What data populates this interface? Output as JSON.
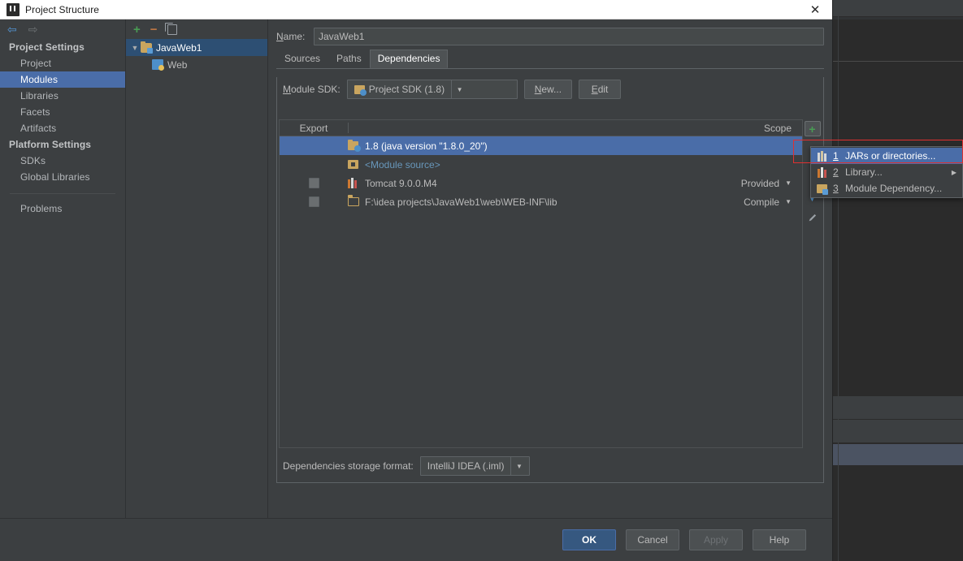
{
  "window": {
    "title": "Project Structure",
    "icon": "intellij-idea-icon",
    "close_label": "✕"
  },
  "nav": {
    "back_icon": "arrow-left-icon",
    "forward_icon": "arrow-right-icon",
    "groups": [
      {
        "label": "Project Settings",
        "items": [
          {
            "label": "Project",
            "selected": false
          },
          {
            "label": "Modules",
            "selected": true
          },
          {
            "label": "Libraries",
            "selected": false
          },
          {
            "label": "Facets",
            "selected": false
          },
          {
            "label": "Artifacts",
            "selected": false
          }
        ]
      },
      {
        "label": "Platform Settings",
        "items": [
          {
            "label": "SDKs",
            "selected": false
          },
          {
            "label": "Global Libraries",
            "selected": false
          }
        ]
      }
    ],
    "problems": "Problems"
  },
  "tree": {
    "toolbar": {
      "add": "+",
      "remove": "−",
      "copy_icon": "copy-icon"
    },
    "nodes": [
      {
        "label": "JavaWeb1",
        "selected": true,
        "expanded": true,
        "icon": "module-icon",
        "indent": 0
      },
      {
        "label": "Web",
        "selected": false,
        "icon": "web-facet-icon",
        "indent": 1
      }
    ]
  },
  "module": {
    "name_label": "Name:",
    "name_value": "JavaWeb1",
    "tabs": [
      {
        "label": "Sources",
        "active": false
      },
      {
        "label": "Paths",
        "active": false
      },
      {
        "label": "Dependencies",
        "active": true
      }
    ],
    "sdk": {
      "label": "Module SDK:",
      "value": "Project SDK (1.8)",
      "icon": "sdk-icon",
      "new_button": "New...",
      "edit_button": "Edit"
    },
    "table": {
      "columns": [
        "Export",
        "Scope"
      ],
      "rows": [
        {
          "checkbox": false,
          "show_checkbox": false,
          "icon": "jdk-icon",
          "name": "1.8 (java version \"1.8.0_20\")",
          "scope": "",
          "selected": true,
          "link": false
        },
        {
          "checkbox": false,
          "show_checkbox": false,
          "icon": "module-source-icon",
          "name": "<Module source>",
          "scope": "",
          "selected": false,
          "link": true
        },
        {
          "checkbox": false,
          "show_checkbox": true,
          "icon": "library-icon",
          "name": "Tomcat 9.0.0.M4",
          "scope": "Provided",
          "selected": false,
          "link": false
        },
        {
          "checkbox": false,
          "show_checkbox": true,
          "icon": "folder-icon",
          "name": "F:\\idea projects\\JavaWeb1\\web\\WEB-INF\\lib",
          "scope": "Compile",
          "selected": false,
          "link": false
        }
      ]
    },
    "side_toolbar": [
      {
        "icon": "add-icon",
        "name": "add-dependency-button",
        "active": true
      },
      {
        "icon": "move-down-icon",
        "name": "move-down-button",
        "active": false
      },
      {
        "icon": "edit-pencil-icon",
        "name": "edit-button",
        "active": false
      }
    ],
    "storage": {
      "label": "Dependencies storage format:",
      "value": "IntelliJ IDEA (.iml)"
    }
  },
  "popup": {
    "items": [
      {
        "num": "1",
        "label": "JARs or directories...",
        "icon": "jars-icon",
        "selected": true,
        "submenu": false
      },
      {
        "num": "2",
        "label": "Library...",
        "icon": "library-icon",
        "selected": false,
        "submenu": true
      },
      {
        "num": "3",
        "label": "Module Dependency...",
        "icon": "module-dependency-icon",
        "selected": false,
        "submenu": false
      }
    ],
    "submenu_arrow": "▶"
  },
  "footer": {
    "ok": "OK",
    "cancel": "Cancel",
    "apply": "Apply",
    "help": "Help"
  },
  "colors": {
    "dialog_bg": "#3c3f41",
    "selection_blue": "#4a6da8",
    "primary_button": "#365880",
    "annotation_red": "#e03030",
    "link_blue": "#6897bb",
    "ide_bg": "#2b2b2b"
  }
}
